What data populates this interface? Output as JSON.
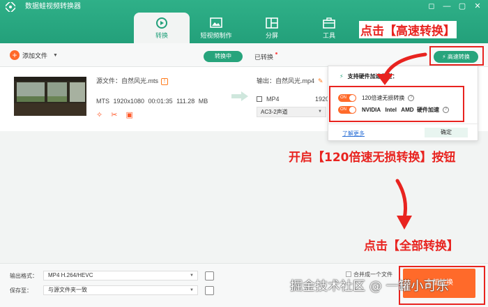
{
  "app": {
    "title": "数据蛙视频转换器",
    "window_controls": [
      "◻",
      "—",
      "▢",
      "✕"
    ]
  },
  "nav": {
    "tabs": [
      {
        "label": "转换",
        "icon": "convert-icon",
        "active": true
      },
      {
        "label": "短视频制作",
        "icon": "image-icon",
        "active": false
      },
      {
        "label": "分屏",
        "icon": "split-screen-icon",
        "active": false
      },
      {
        "label": "工具",
        "icon": "toolbox-icon",
        "active": false
      }
    ]
  },
  "toolbar": {
    "add_file": "添加文件",
    "tab_converting": "转换中",
    "tab_converted": "已转换",
    "speed_button": "高速转换"
  },
  "file": {
    "source": "源文件：自然风光.mts",
    "meta": "MTS  1920x1080  00:01:35  111.28 MB",
    "output": "输出：自然风光.mp4",
    "output_format": "MP4",
    "output_extra": "1920",
    "audio": "AC3-2声道"
  },
  "popup": {
    "title": "支持硬件加速类型：",
    "toggle_state": "ON",
    "option1": "120倍速无损转换",
    "option2": "NVIDIA   Intel   AMD  硬件加速",
    "learn_more": "了解更多",
    "ok": "确定"
  },
  "annotations": {
    "step1": "点击【高速转换】",
    "step2": "开启【120倍速无损转换】按钮",
    "step3": "点击【全部转换】",
    "color": "#e8231f"
  },
  "bottom": {
    "format_label": "输出格式：",
    "format_value": "MP4 H.264/HEVC",
    "save_label": "保存至：",
    "save_value": "与源文件夹一致",
    "merge_label": "合并成一个文件",
    "convert_all": "全部转换"
  },
  "watermark": "掘金技术社区 @ 一罐小可乐",
  "colors": {
    "accent": "#27a47c",
    "orange": "#ff6a2a"
  }
}
